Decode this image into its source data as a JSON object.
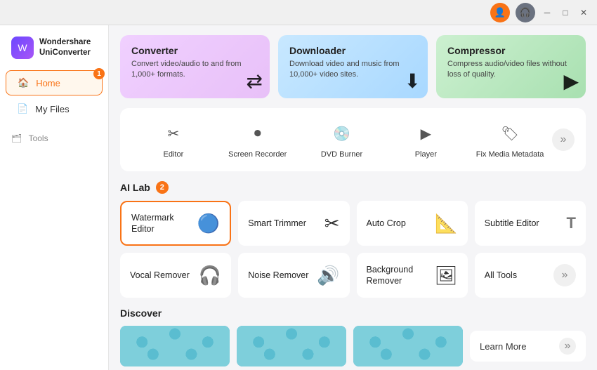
{
  "titlebar": {
    "controls": [
      "user-icon",
      "headset-icon",
      "minimize",
      "maximize",
      "close"
    ]
  },
  "sidebar": {
    "logo": {
      "icon": "W",
      "line1": "Wondershare",
      "line2": "UniConverter"
    },
    "items": [
      {
        "id": "home",
        "label": "Home",
        "icon": "🏠",
        "active": true,
        "badge": "1"
      },
      {
        "id": "myfiles",
        "label": "My Files",
        "icon": "📄",
        "active": false
      }
    ],
    "tools_section": "Tools"
  },
  "feature_cards": [
    {
      "id": "converter",
      "title": "Converter",
      "description": "Convert video/audio to and from 1,000+ formats.",
      "icon": "⇄",
      "color": "converter"
    },
    {
      "id": "downloader",
      "title": "Downloader",
      "description": "Download video and music from 10,000+ video sites.",
      "icon": "⬇",
      "color": "downloader"
    },
    {
      "id": "compressor",
      "title": "Compressor",
      "description": "Compress audio/video files without loss of quality.",
      "icon": "▶",
      "color": "compressor"
    }
  ],
  "tools": {
    "items": [
      {
        "id": "editor",
        "label": "Editor",
        "icon": "✂"
      },
      {
        "id": "screen-recorder",
        "label": "Screen Recorder",
        "icon": "⏺"
      },
      {
        "id": "dvd-burner",
        "label": "DVD Burner",
        "icon": "💿"
      },
      {
        "id": "player",
        "label": "Player",
        "icon": "▶"
      },
      {
        "id": "fix-media-metadata",
        "label": "Fix Media Metadata",
        "icon": "🏷"
      }
    ],
    "more_icon": "»"
  },
  "ai_lab": {
    "title": "AI Lab",
    "badge": "2",
    "cards": [
      {
        "id": "watermark-editor",
        "label": "Watermark Editor",
        "icon": "🔵",
        "selected": true
      },
      {
        "id": "smart-trimmer",
        "label": "Smart Trimmer",
        "icon": "✂"
      },
      {
        "id": "auto-crop",
        "label": "Auto Crop",
        "icon": "📐"
      },
      {
        "id": "subtitle-editor",
        "label": "Subtitle Editor",
        "icon": "T"
      },
      {
        "id": "vocal-remover",
        "label": "Vocal Remover",
        "icon": "🎧"
      },
      {
        "id": "noise-remover",
        "label": "Noise Remover",
        "icon": "🔊"
      },
      {
        "id": "background-remover",
        "label": "Background Remover",
        "icon": "🖼"
      },
      {
        "id": "all-tools",
        "label": "All Tools",
        "icon": "»"
      }
    ]
  },
  "discover": {
    "title": "Discover",
    "learn_more_label": "Learn More",
    "chevron": "»"
  }
}
